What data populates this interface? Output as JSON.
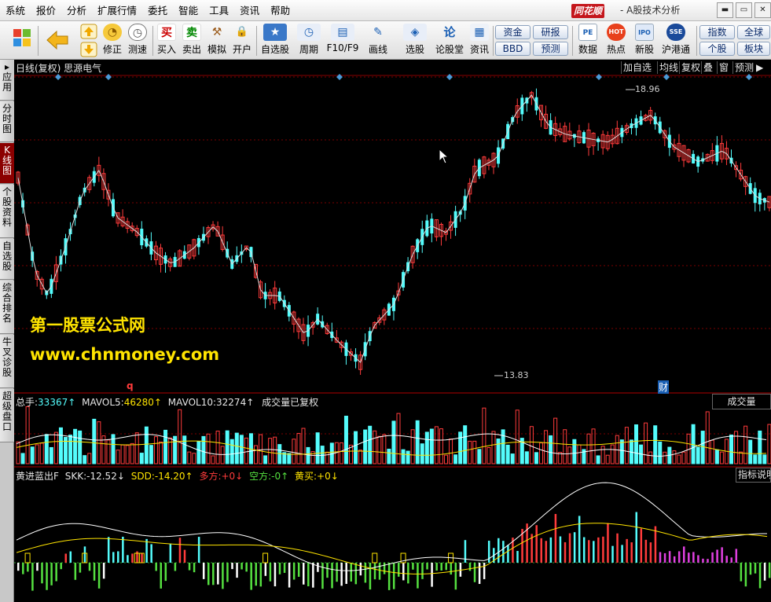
{
  "menu": [
    "系统",
    "报价",
    "分析",
    "扩展行情",
    "委托",
    "智能",
    "工具",
    "资讯",
    "帮助"
  ],
  "brand": "同花顺",
  "app_title": "- A股技术分析",
  "window_controls": [
    "▬",
    "▭",
    "✕"
  ],
  "toolbar": {
    "tools": [
      {
        "id": "buy",
        "label": "买入",
        "glyph": "买",
        "color": "#cc0000"
      },
      {
        "id": "sell",
        "label": "卖出",
        "glyph": "卖",
        "color": "#008800"
      },
      {
        "id": "simulate",
        "label": "模拟",
        "glyph": "⚒",
        "color": "#9a5a1a"
      },
      {
        "id": "open",
        "label": "开户",
        "glyph": "🔒",
        "color": "#b07a00"
      },
      {
        "id": "watchlist",
        "label": "自选股",
        "glyph": "★",
        "color": "#1a5fb4"
      },
      {
        "id": "period",
        "label": "周期",
        "glyph": "◷",
        "color": "#1a5fb4"
      },
      {
        "id": "f10",
        "label": "F10/F9",
        "glyph": "▤",
        "color": "#1a5fb4"
      },
      {
        "id": "draw",
        "label": "画线",
        "glyph": "✎",
        "color": "#1a5fb4"
      },
      {
        "id": "pick",
        "label": "选股",
        "glyph": "◈",
        "color": "#1a5fb4"
      },
      {
        "id": "forum",
        "label": "论股堂",
        "glyph": "论",
        "color": "#1a5fb4"
      },
      {
        "id": "news",
        "label": "资讯",
        "glyph": "▦",
        "color": "#1a5fb4"
      }
    ],
    "fix": "修正",
    "quick": "测速",
    "pills": [
      "资金",
      "研报",
      "BBD",
      "预测"
    ],
    "data_tools": [
      {
        "id": "data",
        "label": "数据",
        "glyph": "PE"
      },
      {
        "id": "hot",
        "label": "热点",
        "glyph": "HOT"
      },
      {
        "id": "newstock",
        "label": "新股",
        "glyph": "IPO"
      },
      {
        "id": "hk",
        "label": "沪港通",
        "glyph": "SSE"
      }
    ],
    "right_pills": [
      "指数",
      "全球",
      "个股",
      "板块"
    ]
  },
  "left_tabs": [
    "应用",
    "分时图",
    "K线图",
    "个股资料",
    "自选股",
    "综合排名",
    "牛叉诊股",
    "超级盘口"
  ],
  "chart_header": {
    "title": "日线(复权) 思源电气",
    "right_buttons": [
      "加自选",
      "均线",
      "复权",
      "叠",
      "窗",
      "预测"
    ]
  },
  "price_labels": {
    "high": "18.96",
    "low": "13.83"
  },
  "markers": {
    "q": "q",
    "cai": "财"
  },
  "watermark": {
    "line1": "第一股票公式网",
    "line2": "www.chnmoney.com"
  },
  "volume_panel": {
    "prefix": "总手:",
    "total": "33367↑",
    "mavol5_label": "MAVOL5:",
    "mavol5": "46280↑",
    "mavol10_label": "MAVOL10:",
    "mavol10": "32274↑",
    "note": "成交量已复权",
    "button": "成交量"
  },
  "indicator_panel": {
    "name": "黄进蓝出F",
    "skk_label": "SKK:",
    "skk": "-12.52↓",
    "sdd_label": "SDD:",
    "sdd": "-14.20↑",
    "duo_label": "多方:",
    "duo": "+0↓",
    "kong_label": "空方:",
    "kong": "-0↑",
    "huang_label": "黄买:",
    "huang": "+0↓",
    "button": "指标说明"
  },
  "colors": {
    "up": "#ff3b3b",
    "down": "#54fcfc",
    "ma": "#ffffff",
    "yellow": "#ffe400",
    "magenta": "#e040e0",
    "green": "#55e040",
    "grid": "#7a0000"
  },
  "icons": [
    "windows-logo-icon",
    "back-arrow-icon",
    "up-arrow-icon",
    "down-arrow-icon",
    "fix-icon",
    "speed-icon",
    "cursor-arrow-icon"
  ]
}
